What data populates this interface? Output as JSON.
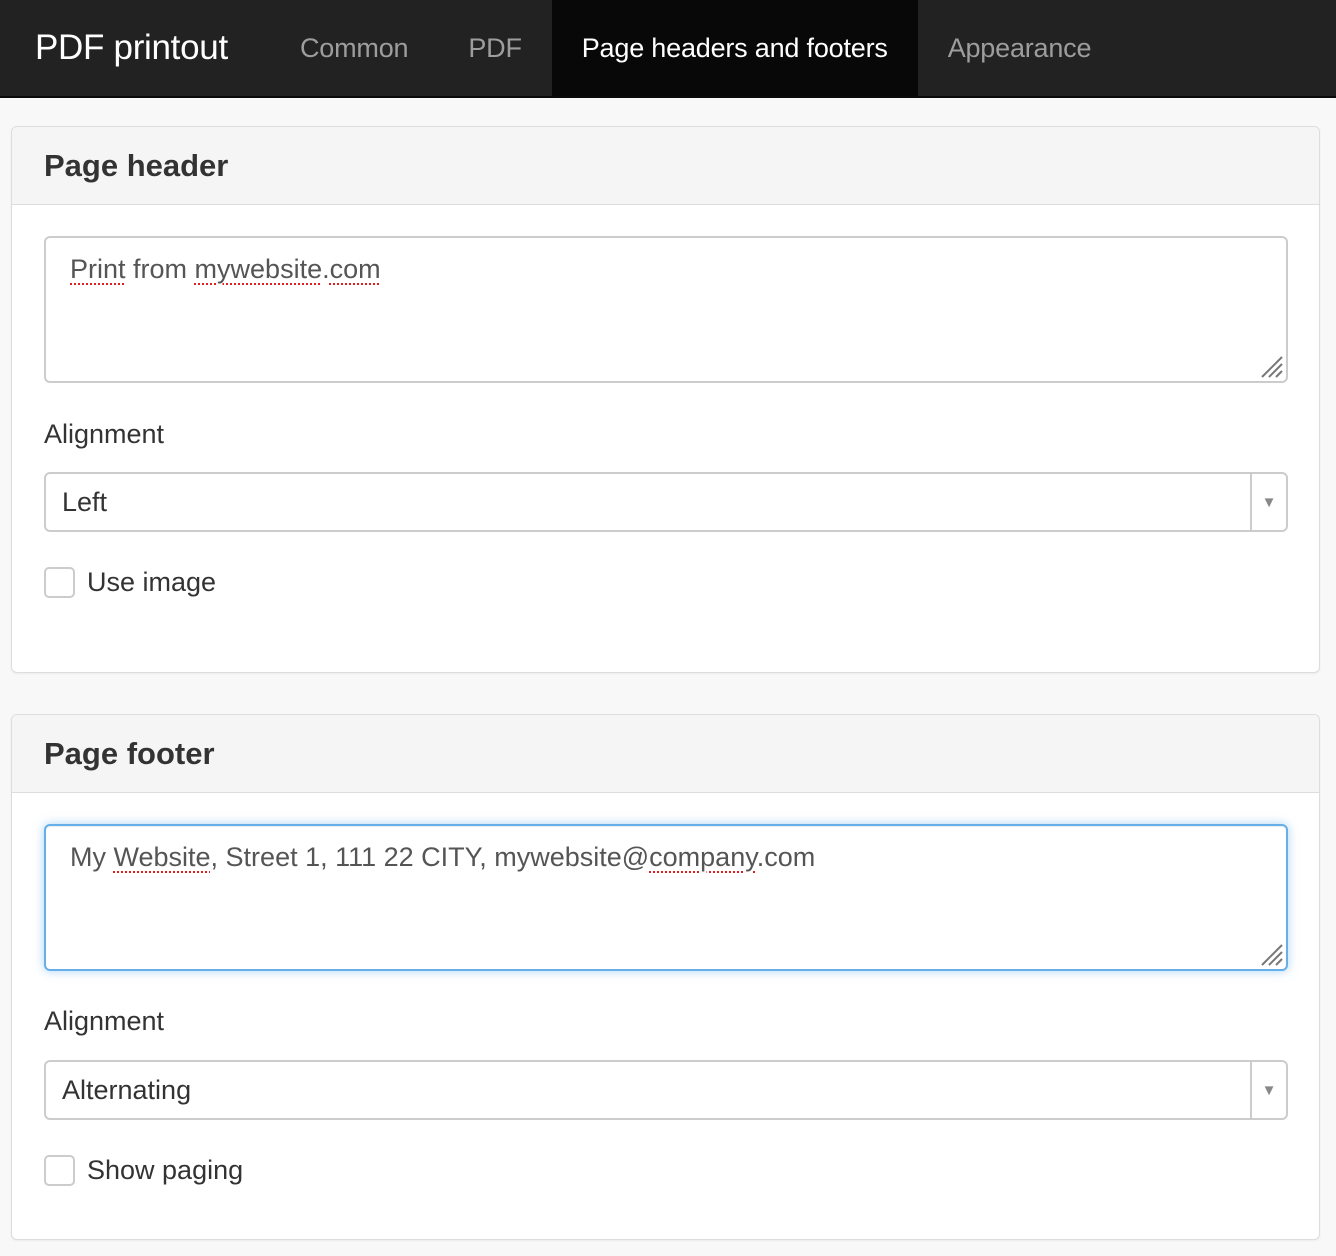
{
  "navbar": {
    "brand": "PDF printout",
    "tabs": [
      {
        "label": "Common",
        "active": false
      },
      {
        "label": "PDF",
        "active": false
      },
      {
        "label": "Page headers and footers",
        "active": true
      },
      {
        "label": "Appearance",
        "active": false
      }
    ]
  },
  "header_panel": {
    "title": "Page header",
    "textarea_value_parts": [
      "Print",
      " from ",
      "mywebsite",
      ".",
      "com"
    ],
    "alignment_label": "Alignment",
    "alignment_value": "Left",
    "checkbox_label": "Use image",
    "checkbox_checked": false
  },
  "footer_panel": {
    "title": "Page footer",
    "textarea_value_parts": [
      "My ",
      "Website",
      ", Street 1, 111 22 CITY, mywebsite@",
      "company",
      ".com"
    ],
    "alignment_label": "Alignment",
    "alignment_value": "Alternating",
    "checkbox_label": "Show paging",
    "checkbox_checked": false
  },
  "colors": {
    "navbar_bg": "#222222",
    "active_tab_bg": "#080808",
    "focus_border": "#66afe9",
    "spellcheck_underline": "#e02020"
  }
}
